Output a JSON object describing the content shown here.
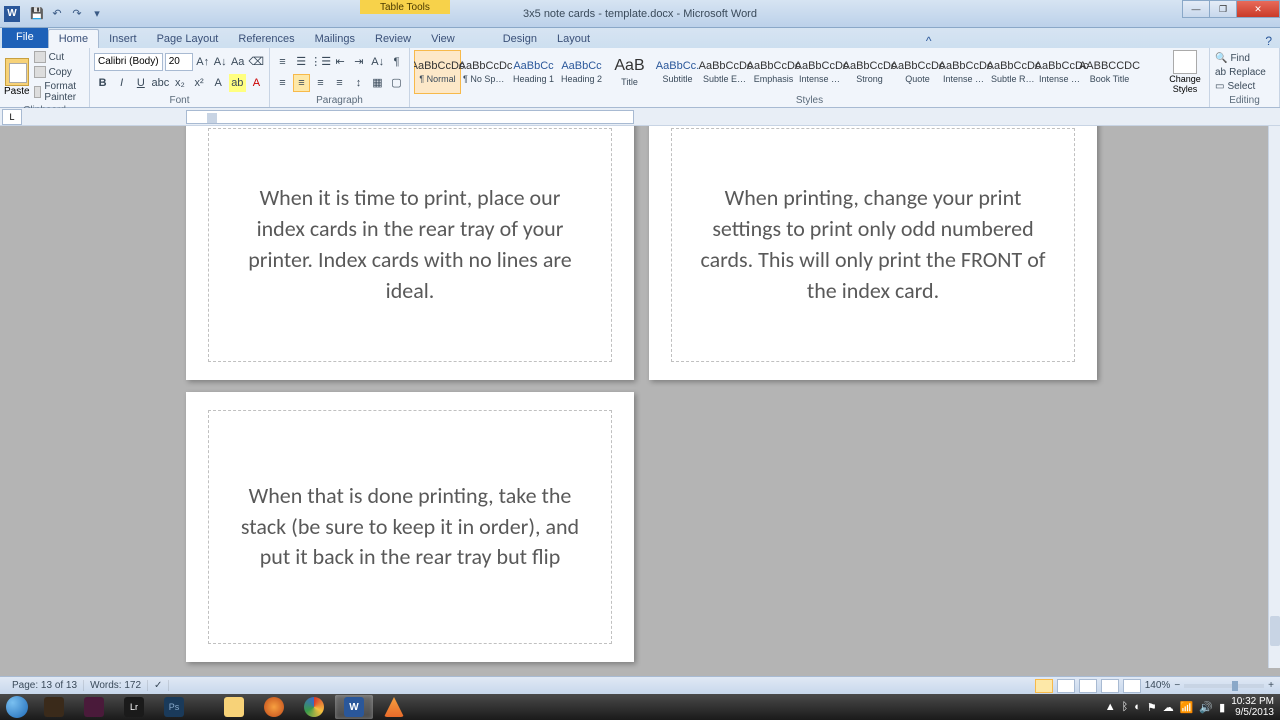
{
  "app": {
    "title": "3x5 note cards - template.docx - Microsoft Word",
    "context_tab_title": "Table Tools"
  },
  "tabs": {
    "file": "File",
    "home": "Home",
    "insert": "Insert",
    "page_layout": "Page Layout",
    "references": "References",
    "mailings": "Mailings",
    "review": "Review",
    "view": "View",
    "design": "Design",
    "layout": "Layout"
  },
  "ribbon": {
    "clipboard": {
      "label": "Clipboard",
      "paste": "Paste",
      "cut": "Cut",
      "copy": "Copy",
      "format_painter": "Format Painter"
    },
    "font": {
      "label": "Font",
      "name": "Calibri (Body)",
      "size": "20"
    },
    "paragraph": {
      "label": "Paragraph"
    },
    "styles": {
      "label": "Styles",
      "items": [
        {
          "preview": "AaBbCcDc",
          "name": "¶ Normal",
          "cls": ""
        },
        {
          "preview": "AaBbCcDc",
          "name": "¶ No Spaci...",
          "cls": ""
        },
        {
          "preview": "AaBbCc",
          "name": "Heading 1",
          "cls": "blue"
        },
        {
          "preview": "AaBbCc",
          "name": "Heading 2",
          "cls": "blue"
        },
        {
          "preview": "AaB",
          "name": "Title",
          "cls": "big"
        },
        {
          "preview": "AaBbCc.",
          "name": "Subtitle",
          "cls": "blue"
        },
        {
          "preview": "AaBbCcDc",
          "name": "Subtle Em...",
          "cls": ""
        },
        {
          "preview": "AaBbCcDc",
          "name": "Emphasis",
          "cls": ""
        },
        {
          "preview": "AaBbCcDc",
          "name": "Intense E...",
          "cls": ""
        },
        {
          "preview": "AaBbCcDc",
          "name": "Strong",
          "cls": ""
        },
        {
          "preview": "AaBbCcDc",
          "name": "Quote",
          "cls": ""
        },
        {
          "preview": "AaBbCcDc",
          "name": "Intense Q...",
          "cls": ""
        },
        {
          "preview": "AaBbCcDc",
          "name": "Subtle Ref...",
          "cls": ""
        },
        {
          "preview": "AaBbCcDc",
          "name": "Intense R...",
          "cls": ""
        },
        {
          "preview": "AABBCCDC",
          "name": "Book Title",
          "cls": ""
        }
      ],
      "change_styles": "Change Styles"
    },
    "editing": {
      "label": "Editing",
      "find": "Find",
      "replace": "Replace",
      "select": "Select"
    }
  },
  "cards": [
    {
      "text": "When it is time to print, place our index cards in the rear tray of your printer.  Index cards with no lines are ideal."
    },
    {
      "text": "When printing, change your print settings to print only odd numbered cards.  This will only print the FRONT of the index card."
    },
    {
      "text": "When that is done printing, take the stack (be sure to keep it in order), and put it back in the rear tray but flip"
    }
  ],
  "statusbar": {
    "page": "Page: 13 of 13",
    "words": "Words: 172",
    "zoom": "140%"
  },
  "systray": {
    "time": "10:32 PM",
    "date": "9/5/2013"
  }
}
